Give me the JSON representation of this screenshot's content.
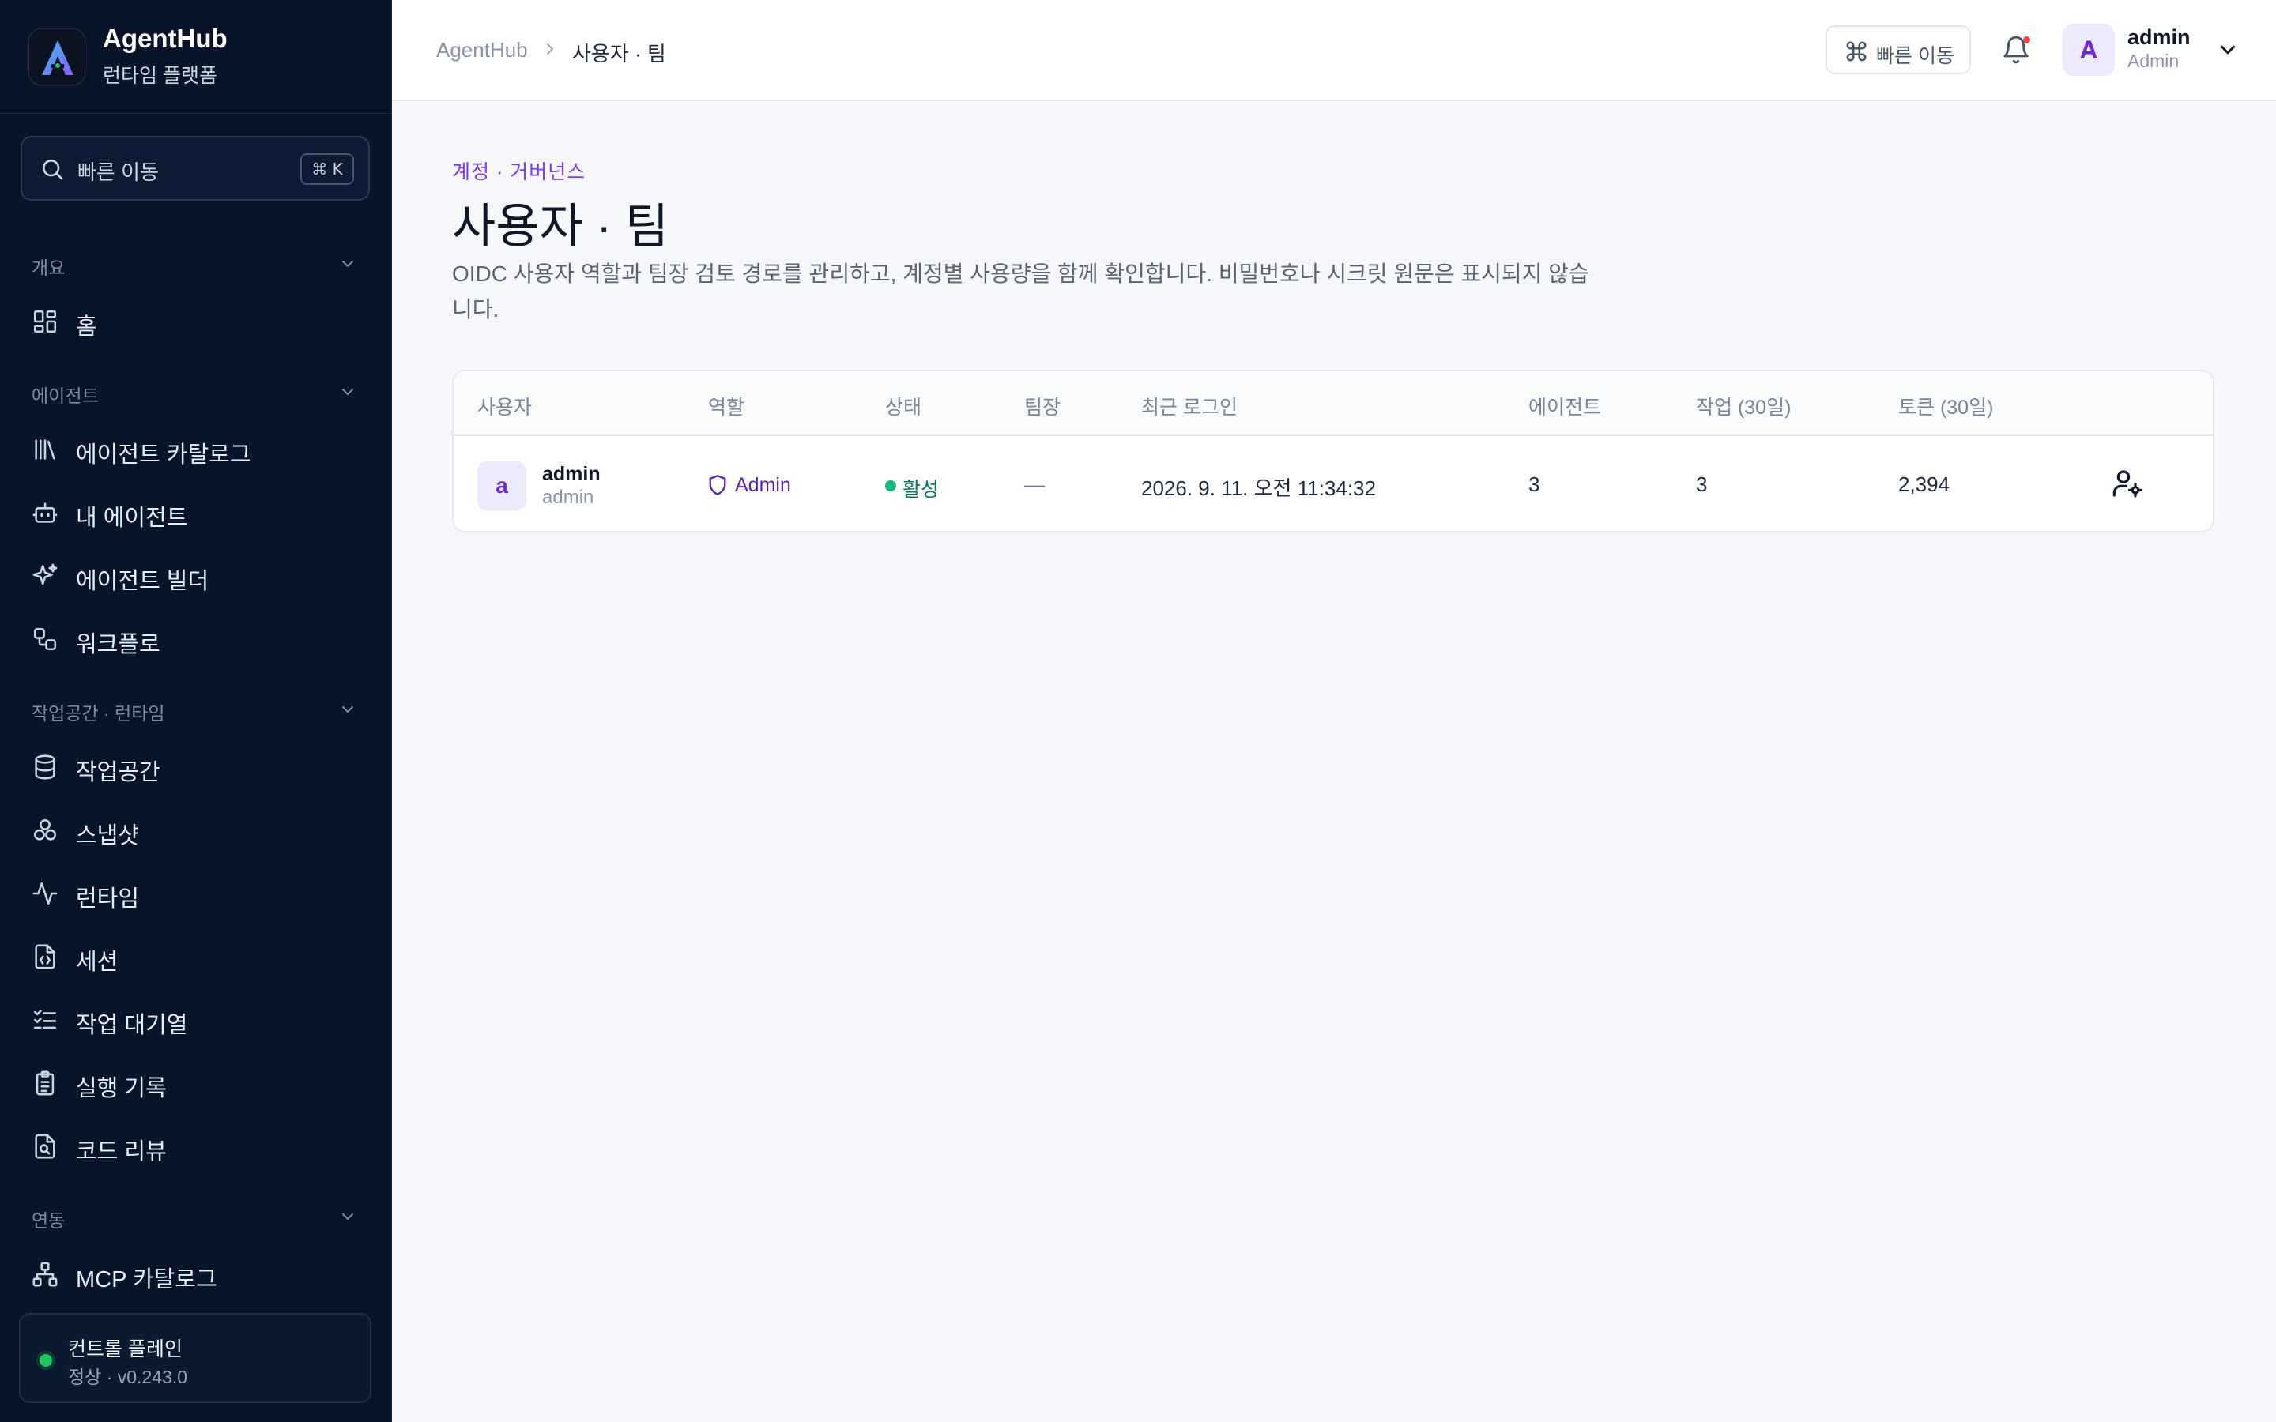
{
  "brand": {
    "title": "AgentHub",
    "subtitle": "런타임 플랫폼"
  },
  "search": {
    "label": "빠른 이동",
    "shortcut": "⌘ K"
  },
  "sidebar": {
    "sections": [
      {
        "label": "개요",
        "items": [
          {
            "label": "홈",
            "icon": "home-grid-icon"
          }
        ]
      },
      {
        "label": "에이전트",
        "items": [
          {
            "label": "에이전트 카탈로그",
            "icon": "library-icon"
          },
          {
            "label": "내 에이전트",
            "icon": "bot-icon"
          },
          {
            "label": "에이전트 빌더",
            "icon": "sparkles-icon"
          },
          {
            "label": "워크플로",
            "icon": "workflow-icon"
          }
        ]
      },
      {
        "label": "작업공간 · 런타임",
        "items": [
          {
            "label": "작업공간",
            "icon": "database-icon"
          },
          {
            "label": "스냅샷",
            "icon": "boxes-icon"
          },
          {
            "label": "런타임",
            "icon": "activity-icon"
          },
          {
            "label": "세션",
            "icon": "file-code-icon"
          },
          {
            "label": "작업 대기열",
            "icon": "list-checks-icon"
          },
          {
            "label": "실행 기록",
            "icon": "clipboard-list-icon"
          },
          {
            "label": "코드 리뷰",
            "icon": "file-search-icon"
          }
        ]
      },
      {
        "label": "연동",
        "items": [
          {
            "label": "MCP 카탈로그",
            "icon": "network-icon"
          }
        ]
      }
    ]
  },
  "control_plane": {
    "title": "컨트롤 플레인",
    "status": "정상 · v0.243.0",
    "status_color": "#22c55e"
  },
  "topbar": {
    "breadcrumb": [
      "AgentHub",
      "사용자 · 팀"
    ],
    "quick_jump_label": "빠른 이동",
    "user": {
      "initial": "A",
      "name": "admin",
      "role": "Admin"
    }
  },
  "page": {
    "eyebrow": "계정 · 거버넌스",
    "title": "사용자 · 팀",
    "description": "OIDC 사용자 역할과 팀장 검토 경로를 관리하고, 계정별 사용량을 함께 확인합니다. 비밀번호나 시크릿 원문은 표시되지 않습니다."
  },
  "table": {
    "headers": {
      "user": "사용자",
      "role": "역할",
      "status": "상태",
      "lead": "팀장",
      "last_login": "최근 로그인",
      "agents": "에이전트",
      "jobs": "작업 (30일)",
      "tokens": "토큰 (30일)"
    },
    "rows": [
      {
        "initial": "a",
        "name": "admin",
        "login": "admin",
        "role": "Admin",
        "status": "활성",
        "lead": "—",
        "last_login": "2026. 9. 11. 오전 11:34:32",
        "agents": "3",
        "jobs": "3",
        "tokens": "2,394"
      }
    ]
  },
  "colors": {
    "accent": "#7c3aed",
    "sidebar_bg": "#07142a",
    "active": "#10b981"
  }
}
